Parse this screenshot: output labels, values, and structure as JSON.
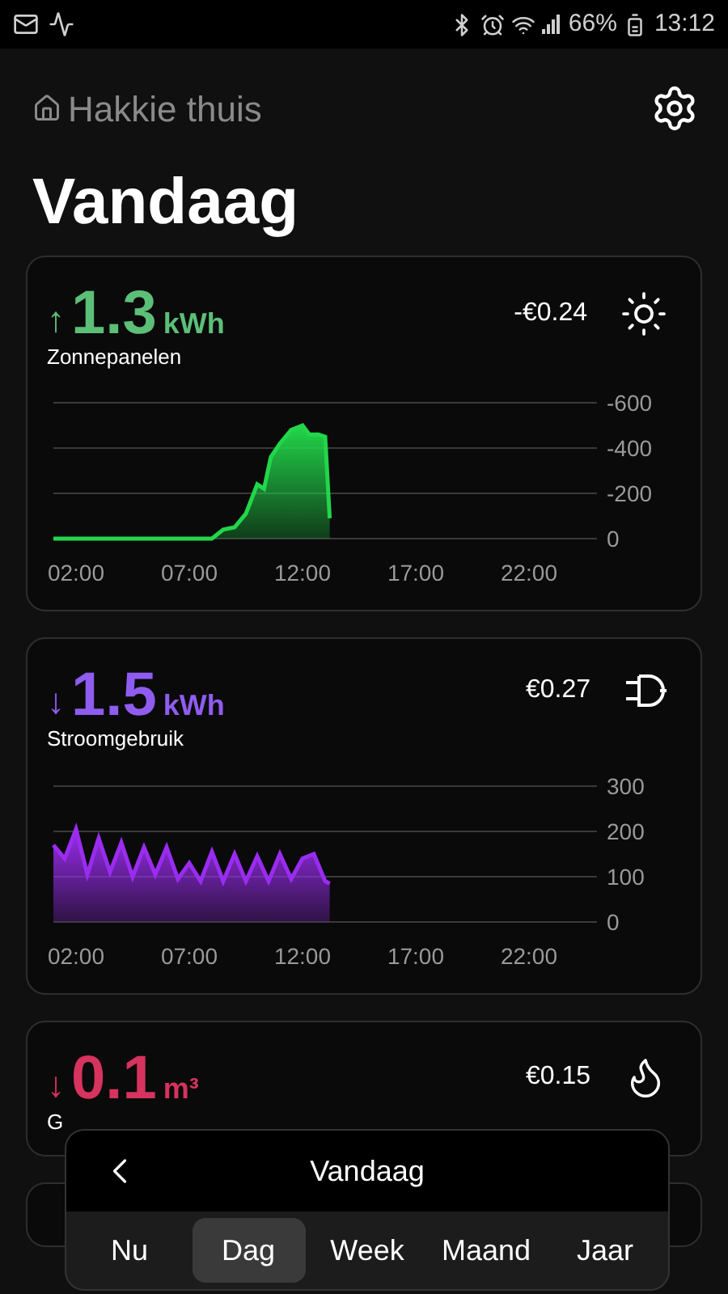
{
  "status_bar": {
    "battery": "66%",
    "time": "13:12"
  },
  "header": {
    "home": "Hakkie thuis"
  },
  "title": "Vandaag",
  "cards": [
    {
      "arrow": "↑",
      "amount": "1.3",
      "unit": "kWh",
      "label": "Zonnepanelen",
      "cost": "-€0.24",
      "kind": "solar",
      "color": "#5cbf78",
      "chart_data": {
        "type": "area",
        "x": [
          1,
          2,
          3,
          4,
          5,
          6,
          7,
          8,
          8.5,
          9,
          9.5,
          10,
          10.3,
          10.6,
          11,
          11.5,
          12,
          12.3,
          12.7,
          13,
          13.2
        ],
        "series": [
          {
            "color": "#22d64a",
            "values": [
              0,
              0,
              0,
              0,
              0,
              0,
              0,
              0,
              -40,
              -50,
              -110,
              -240,
              -220,
              -360,
              -420,
              -480,
              -500,
              -460,
              -460,
              -450,
              -90
            ]
          }
        ],
        "xlim": [
          1,
          25
        ],
        "ylim": [
          0,
          -600
        ],
        "xticks": [
          {
            "value": 2,
            "label": "02:00"
          },
          {
            "value": 7,
            "label": "07:00"
          },
          {
            "value": 12,
            "label": "12:00"
          },
          {
            "value": 17,
            "label": "17:00"
          },
          {
            "value": 22,
            "label": "22:00"
          }
        ],
        "yticks": [
          -600,
          -400,
          -200,
          0
        ]
      }
    },
    {
      "arrow": "↓",
      "amount": "1.5",
      "unit": "kWh",
      "label": "Stroomgebruik",
      "cost": "€0.27",
      "kind": "power",
      "color": "#8f5cf0",
      "chart_data": {
        "type": "area",
        "x": [
          1,
          1.5,
          2,
          2.5,
          3,
          3.5,
          4,
          4.5,
          5,
          5.5,
          6,
          6.5,
          7,
          7.5,
          8,
          8.5,
          9,
          9.5,
          10,
          10.5,
          11,
          11.5,
          12,
          12.5,
          13,
          13.2
        ],
        "series": [
          {
            "color": "#9a2cf0",
            "values": [
              170,
              140,
              205,
              105,
              185,
              110,
              175,
              100,
              165,
              105,
              165,
              95,
              130,
              90,
              155,
              90,
              150,
              90,
              145,
              90,
              150,
              95,
              140,
              150,
              90,
              85
            ]
          }
        ],
        "xlim": [
          1,
          25
        ],
        "ylim": [
          0,
          300
        ],
        "xticks": [
          {
            "value": 2,
            "label": "02:00"
          },
          {
            "value": 7,
            "label": "07:00"
          },
          {
            "value": 12,
            "label": "12:00"
          },
          {
            "value": 17,
            "label": "17:00"
          },
          {
            "value": 22,
            "label": "22:00"
          }
        ],
        "yticks": [
          300,
          200,
          100,
          0
        ]
      }
    },
    {
      "arrow": "↓",
      "amount": "0.1",
      "unit": "m³",
      "label": "G",
      "cost": "€0.15",
      "kind": "gas",
      "color": "#d6335e"
    }
  ],
  "period_picker": {
    "title": "Vandaag",
    "tabs": [
      {
        "label": "Nu",
        "selected": false
      },
      {
        "label": "Dag",
        "selected": true
      },
      {
        "label": "Week",
        "selected": false
      },
      {
        "label": "Maand",
        "selected": false
      },
      {
        "label": "Jaar",
        "selected": false
      }
    ]
  }
}
